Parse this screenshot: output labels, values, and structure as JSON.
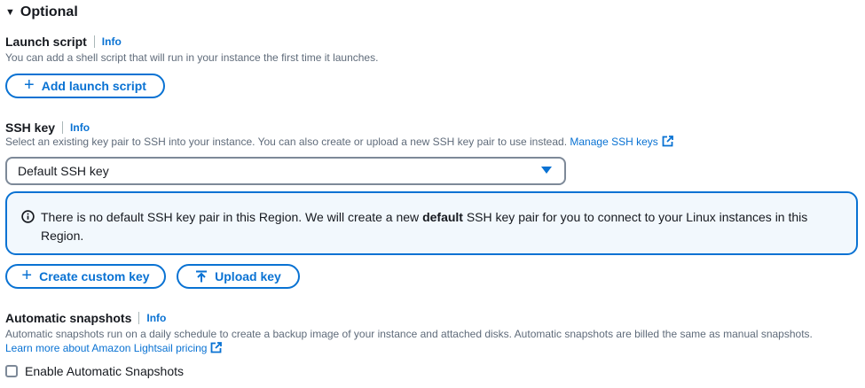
{
  "section": {
    "title": "Optional"
  },
  "launch_script": {
    "label": "Launch script",
    "info": "Info",
    "description": "You can add a shell script that will run in your instance the first time it launches.",
    "add_button": "Add launch script"
  },
  "ssh_key": {
    "label": "SSH key",
    "info": "Info",
    "description": "Select an existing key pair to SSH into your instance. You can also create or upload a new SSH key pair to use instead.",
    "manage_link": "Manage SSH keys",
    "selected_value": "Default SSH key",
    "alert_prefix": "There is no default SSH key pair in this Region. We will create a new ",
    "alert_bold": "default",
    "alert_suffix": " SSH key pair for you to connect to your Linux instances in this Region.",
    "create_button": "Create custom key",
    "upload_button": "Upload key"
  },
  "snapshots": {
    "label": "Automatic snapshots",
    "info": "Info",
    "description": "Automatic snapshots run on a daily schedule to create a backup image of your instance and attached disks. Automatic snapshots are billed the same as manual snapshots.",
    "pricing_link": "Learn more about Amazon Lightsail pricing",
    "checkbox_label": "Enable Automatic Snapshots",
    "checkbox_checked": false
  },
  "colors": {
    "accent": "#0972d3",
    "alert_bg": "#f2f8fd",
    "muted_text": "#5f6b7a"
  }
}
